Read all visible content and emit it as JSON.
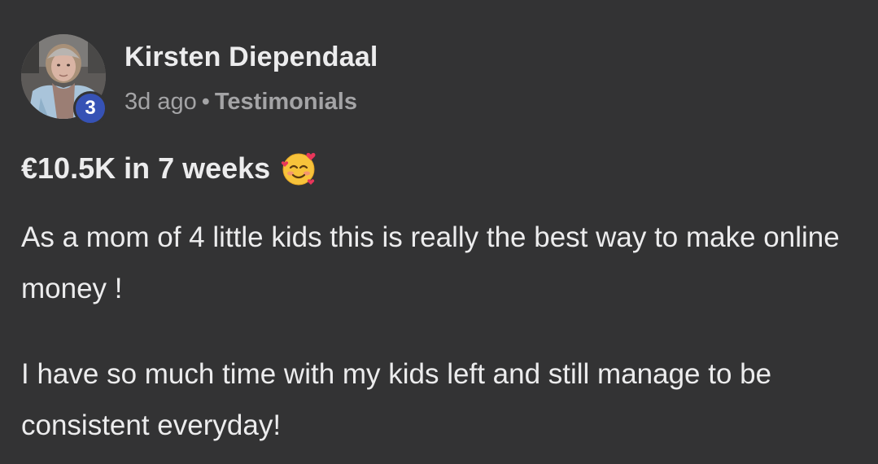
{
  "author": {
    "name": "Kirsten Diependaal",
    "level": "3",
    "avatar_icon": "profile-photo"
  },
  "meta": {
    "time": "3d ago",
    "separator": "•",
    "category": "Testimonials"
  },
  "post": {
    "title": "€10.5K in 7 weeks",
    "title_emoji": "smiling-face-with-hearts-icon",
    "paragraphs": [
      "As a mom of 4 little kids this is really the best way to make online money !",
      "I have so much time with my kids left and still manage to be consistent everyday!"
    ]
  },
  "colors": {
    "background": "#333334",
    "badge": "#3652b5",
    "meta_text": "#a4a4a6",
    "text": "#ececed"
  }
}
